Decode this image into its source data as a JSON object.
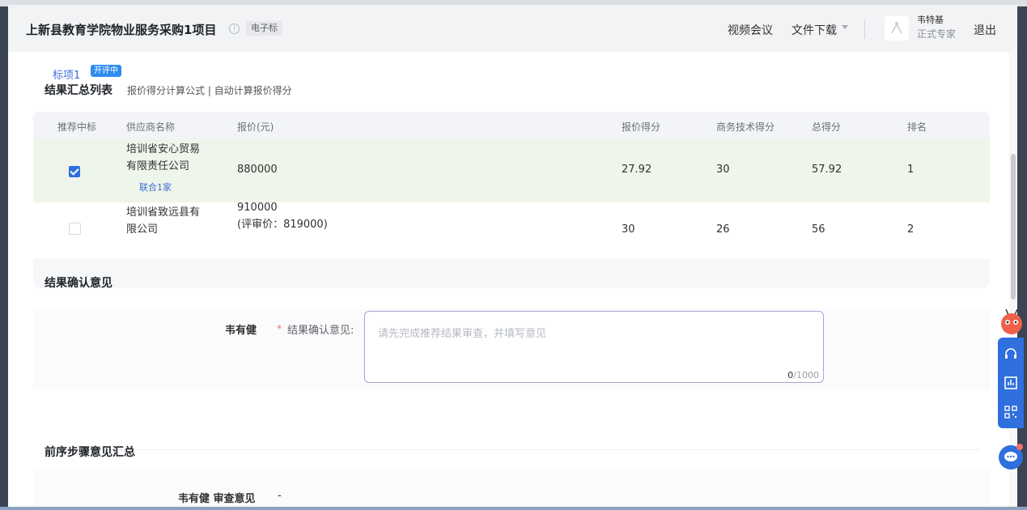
{
  "header": {
    "title": "上新县教育学院物业服务采购1项目",
    "tag": "电子标",
    "nav": [
      "视频会议",
      "文件下载"
    ],
    "user_name": "韦特基",
    "user_role": "正式专家",
    "logout": "退出"
  },
  "tab": {
    "label": "标项1",
    "badge": "开评中"
  },
  "summary": {
    "title": "结果汇总列表",
    "links": "报价得分计算公式 | 自动计算报价得分",
    "columns": [
      "推荐中标",
      "供应商名称",
      "报价(元)",
      "报价得分",
      "商务技术得分",
      "总得分",
      "排名"
    ],
    "rows": [
      {
        "checked": true,
        "name_line1": "培训省安心贸易",
        "name_line2": "有限责任公司",
        "union": "联合1家",
        "price": "880000",
        "price_note": "",
        "price_score": "27.92",
        "biz_score": "30",
        "total": "57.92",
        "rank": "1"
      },
      {
        "checked": false,
        "name_line1": "培训省致远县有",
        "name_line2": "限公司",
        "union": "",
        "price": "910000",
        "price_note": "(评审价：819000)",
        "price_score": "30",
        "biz_score": "26",
        "total": "56",
        "rank": "2"
      }
    ]
  },
  "confirm": {
    "title": "结果确认意见",
    "reviewer": "韦有健",
    "field_label": "结果确认意见:",
    "placeholder": "请先完成推荐结果审查，并填写意见",
    "count": "0",
    "max": "/1000"
  },
  "previous": {
    "title": "前序步骤意见汇总",
    "reviewer_label": "韦有健 审查意见",
    "value": "-"
  },
  "colors": {
    "accent": "#2f6fde",
    "selected_row": "#eef5ea",
    "required": "#f56c6c"
  }
}
